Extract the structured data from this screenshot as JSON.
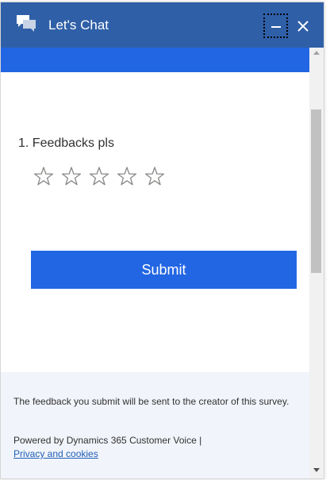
{
  "header": {
    "title": "Let's Chat",
    "chat_icon": "chat-bubbles-icon",
    "minimize_icon": "minimize-icon",
    "close_icon": "close-icon",
    "background_color": "#2f5fa7"
  },
  "survey": {
    "question": "1. Feedbacks pls",
    "rating": {
      "max": 5,
      "selected": 0,
      "icon": "star-outline-icon"
    },
    "submit_label": "Submit",
    "accent_color": "#2266e3"
  },
  "footer": {
    "note": "The feedback you submit will be sent to the creator of this survey.",
    "powered_by": "Powered by Dynamics 365 Customer Voice |",
    "privacy_link": "Privacy and cookies"
  }
}
